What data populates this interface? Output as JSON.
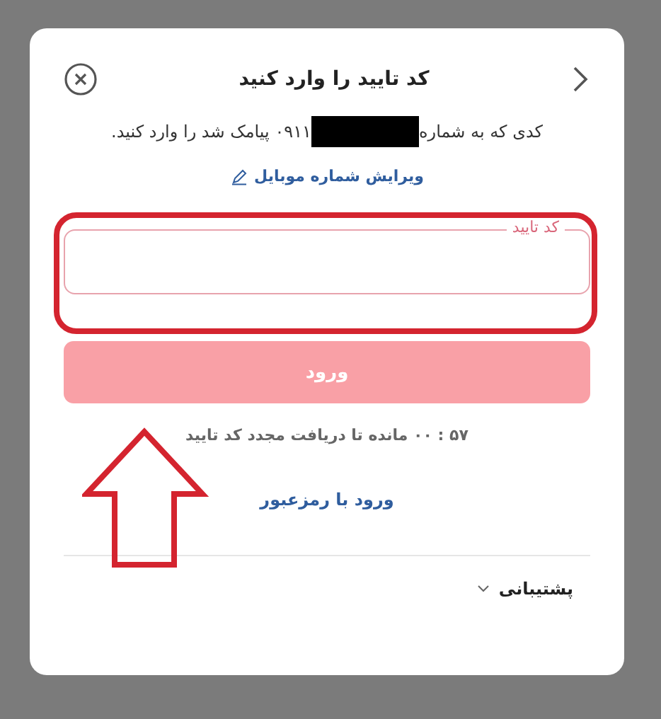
{
  "dialog": {
    "title": "کد تایید را وارد کنید",
    "message": {
      "before": "کدی که به شماره",
      "after": "۰۹۱۱ پیامک شد را وارد کنید.",
      "redacted": true
    },
    "edit_link": "ویرایش شماره موبایل",
    "code_field": {
      "label": "کد تایید",
      "focused": true
    },
    "submit": {
      "label": "ورود",
      "disabled": true
    },
    "timer": "۵۷ : ۰۰ مانده تا دریافت مجدد کد تایید",
    "password_link": "ورود با رمزعبور",
    "support": {
      "label": "پشتیبانی",
      "expanded": false
    }
  }
}
